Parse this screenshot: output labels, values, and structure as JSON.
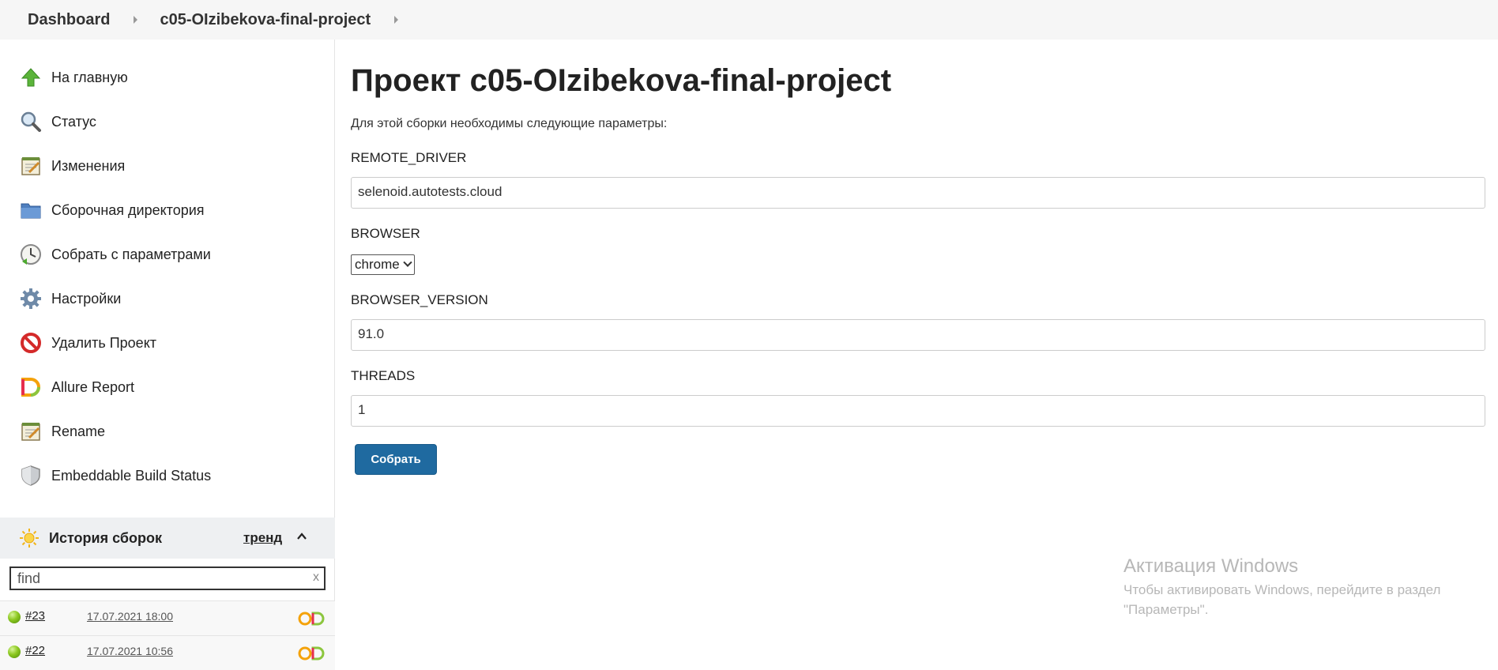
{
  "breadcrumb": {
    "home": "Dashboard",
    "project": "c05-OIzibekova-final-project"
  },
  "sidebar": {
    "items": [
      {
        "label": "На главную",
        "icon": "up-arrow-icon"
      },
      {
        "label": "Статус",
        "icon": "magnifier-icon"
      },
      {
        "label": "Изменения",
        "icon": "notepad-icon"
      },
      {
        "label": "Сборочная директория",
        "icon": "folder-icon"
      },
      {
        "label": "Собрать с параметрами",
        "icon": "clock-icon"
      },
      {
        "label": "Настройки",
        "icon": "gear-icon"
      },
      {
        "label": "Удалить Проект",
        "icon": "no-entry-icon"
      },
      {
        "label": "Allure Report",
        "icon": "allure-icon"
      },
      {
        "label": "Rename",
        "icon": "notepad-icon"
      },
      {
        "label": "Embeddable Build Status",
        "icon": "shield-icon"
      }
    ]
  },
  "build_history": {
    "title": "История сборок",
    "trend": "тренд",
    "search_value": "find",
    "clear": "x",
    "builds": [
      {
        "number": "#23",
        "date": "17.07.2021 18:00"
      },
      {
        "number": "#22",
        "date": "17.07.2021 10:56"
      }
    ]
  },
  "main": {
    "title": "Проект c05-OIzibekova-final-project",
    "description": "Для этой сборки необходимы следующие параметры:",
    "params": {
      "remote_driver": {
        "label": "REMOTE_DRIVER",
        "value": "selenoid.autotests.cloud"
      },
      "browser": {
        "label": "BROWSER",
        "value": "chrome"
      },
      "browser_version": {
        "label": "BROWSER_VERSION",
        "value": "91.0"
      },
      "threads": {
        "label": "THREADS",
        "value": "1"
      }
    },
    "submit_label": "Собрать"
  },
  "watermark": {
    "title": "Активация Windows",
    "line1": "Чтобы активировать Windows, перейдите в раздел",
    "line2": "\"Параметры\"."
  },
  "colors": {
    "accent": "#1f6aa0",
    "sidebar_header_bg": "#eef0f2",
    "breadcrumb_bg": "#f6f6f6"
  }
}
